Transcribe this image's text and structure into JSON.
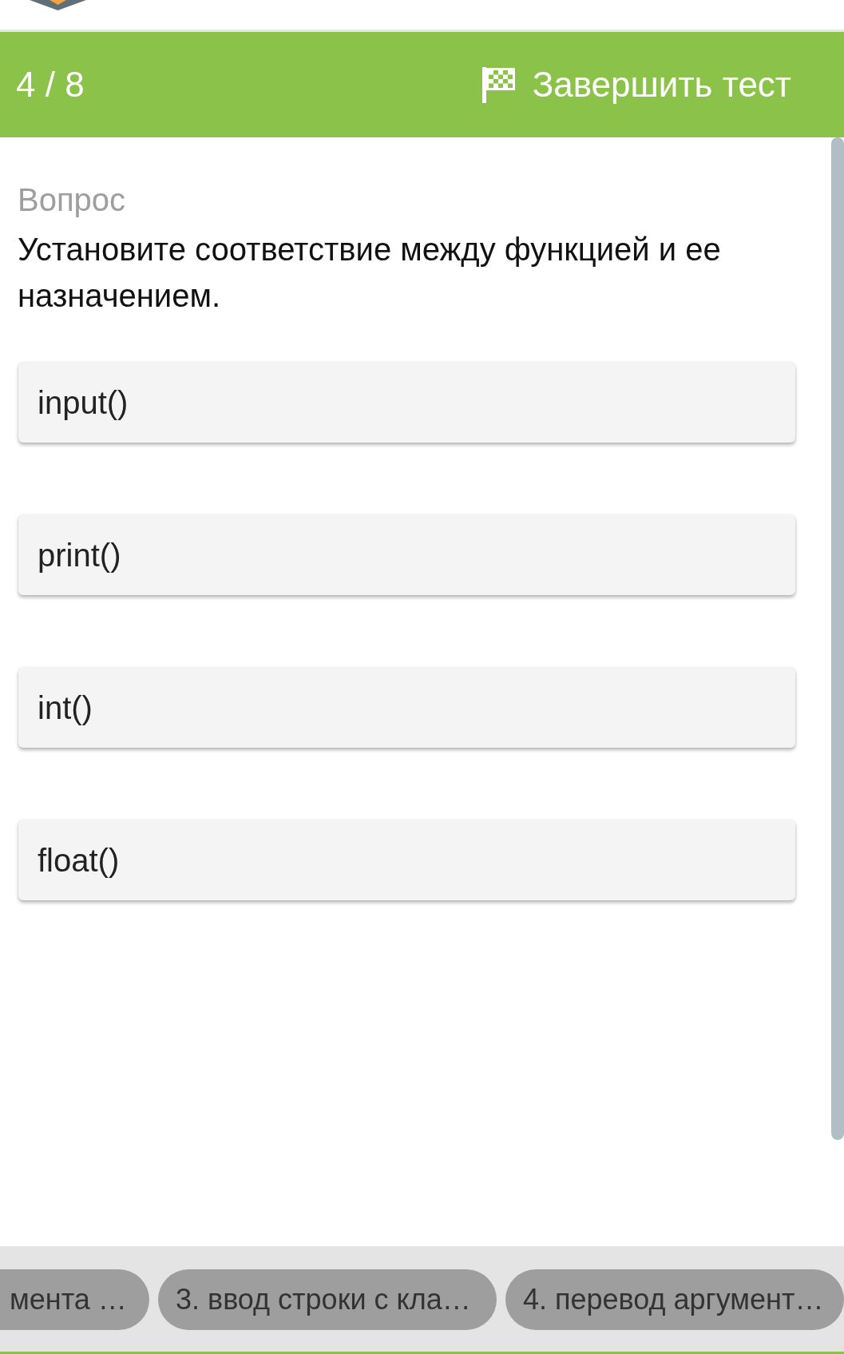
{
  "header": {
    "counter": "4 / 8",
    "finish_button": "Завершить тест"
  },
  "question": {
    "heading": "Вопрос",
    "text": "Установите соответствие между функцией и ее назначением."
  },
  "items": [
    {
      "label": "input()"
    },
    {
      "label": "print()"
    },
    {
      "label": "int()"
    },
    {
      "label": "float()"
    }
  ],
  "answer_tabs": [
    {
      "label": "мента …"
    },
    {
      "label": "3. ввод строки с кла…"
    },
    {
      "label": "4. перевод аргумент…"
    }
  ]
}
